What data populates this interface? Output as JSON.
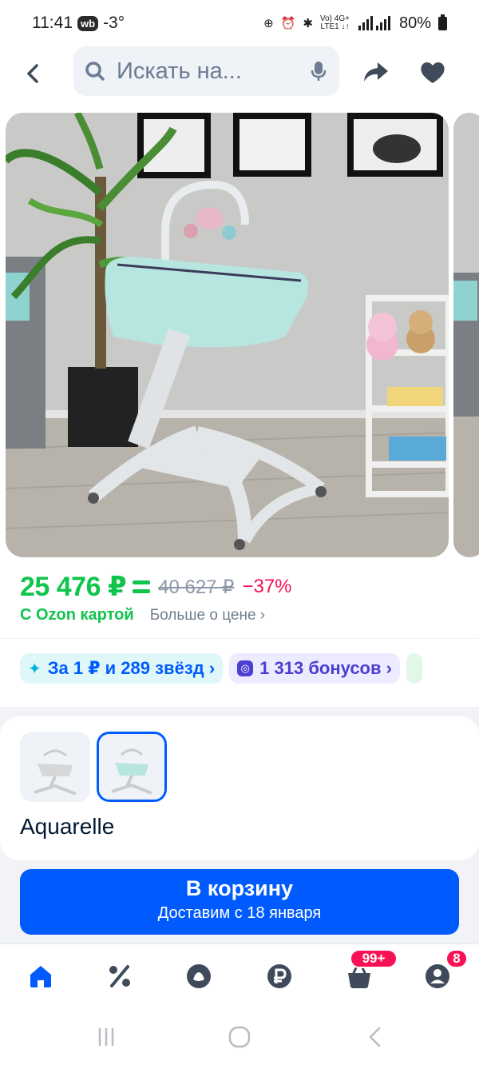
{
  "status_bar": {
    "time": "11:41",
    "app_badge": "wb",
    "temperature": "-3°",
    "net_line1": "Vo) 4G+",
    "net_line2": "LTE1 ↓↑",
    "battery": "80%"
  },
  "header": {
    "search_placeholder": "Искать на..."
  },
  "price": {
    "main": "25 476 ₽",
    "old": "40 627 ₽",
    "discount": "−37%",
    "card_label": "С Ozon картой",
    "more_link": "Больше о цене ›"
  },
  "promos": {
    "stars": "За 1 ₽ и 289 звёзд ›",
    "bonus": "1 313 бонусов ›"
  },
  "variants": {
    "selected_name": "Aquarelle"
  },
  "cart": {
    "title": "В корзину",
    "subtitle": "Доставим с 18 января"
  },
  "bottom_nav": {
    "cart_badge": "99+",
    "profile_badge": "8"
  },
  "colors": {
    "accent": "#005bff",
    "price_green": "#10c44c",
    "discount_red": "#f91155"
  }
}
